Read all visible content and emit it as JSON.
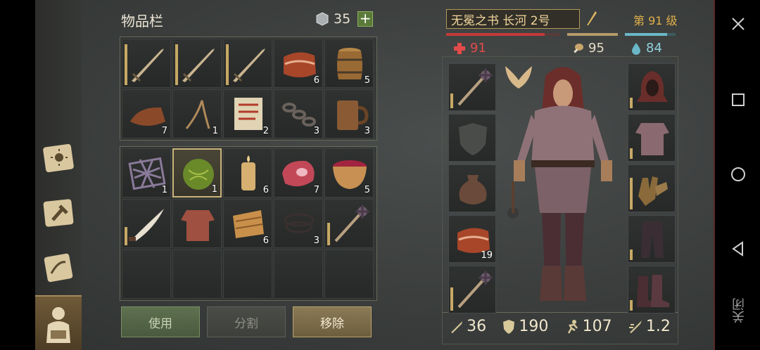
{
  "inventory": {
    "title": "物品栏",
    "coins": "35",
    "plus": "+",
    "slots": [
      {
        "icon": "sword-icon",
        "count": ""
      },
      {
        "icon": "sword-icon",
        "count": ""
      },
      {
        "icon": "sword-icon",
        "count": ""
      },
      {
        "icon": "bacon-icon",
        "count": "6"
      },
      {
        "icon": "barrel-icon",
        "count": "5"
      },
      {
        "icon": "leather-scraps-icon",
        "count": "7"
      },
      {
        "icon": "rope-icon",
        "count": "1"
      },
      {
        "icon": "scroll-icon",
        "count": "2"
      },
      {
        "icon": "chain-icon",
        "count": "3"
      },
      {
        "icon": "mug-icon",
        "count": "3"
      },
      {
        "icon": "grate-icon",
        "count": "1"
      },
      {
        "icon": "cabbage-icon",
        "count": "1"
      },
      {
        "icon": "candle-icon",
        "count": "6"
      },
      {
        "icon": "meat-icon",
        "count": "7"
      },
      {
        "icon": "berry-bowl-icon",
        "count": "5"
      },
      {
        "icon": "scimitar-icon",
        "count": ""
      },
      {
        "icon": "gambeson-icon",
        "count": ""
      },
      {
        "icon": "cloth-icon",
        "count": "6"
      },
      {
        "icon": "cord-icon",
        "count": "3"
      },
      {
        "icon": "mace-icon",
        "count": ""
      }
    ]
  },
  "buttons": {
    "use": "使用",
    "split": "分割",
    "remove": "移除"
  },
  "character": {
    "name": "无冕之书 长河 2号",
    "level": "第 91 级",
    "health": "91",
    "food": "95",
    "water": "84",
    "equipment_left": [
      {
        "icon": "mace-icon",
        "count": ""
      },
      {
        "icon": "shield-slot-icon",
        "count": ""
      },
      {
        "icon": "pouch-icon",
        "count": ""
      },
      {
        "icon": "bacon-icon",
        "count": "19"
      },
      {
        "icon": "mace-icon",
        "count": ""
      }
    ],
    "equipment_right": [
      {
        "icon": "hood-icon"
      },
      {
        "icon": "chainmail-icon"
      },
      {
        "icon": "gloves-icon"
      },
      {
        "icon": "pants-icon"
      },
      {
        "icon": "boots-icon"
      }
    ],
    "attack": "36",
    "armor": "190",
    "speed": "107",
    "attack_speed": "1.2"
  },
  "android_nav": {
    "close": "关闭"
  }
}
